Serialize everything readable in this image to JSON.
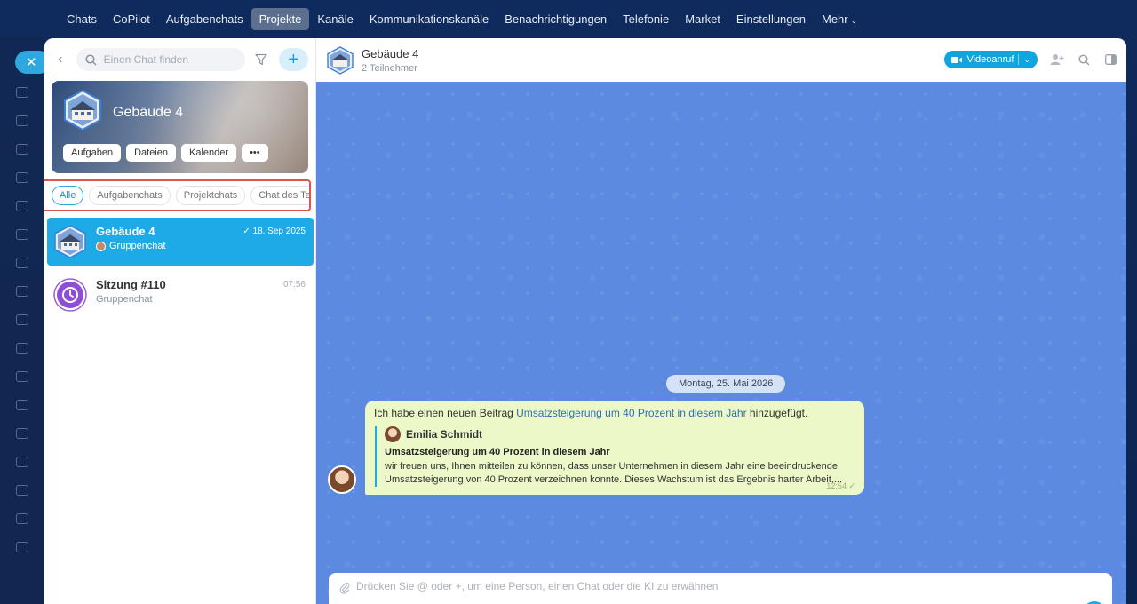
{
  "topnav": {
    "items": [
      "Chats",
      "CoPilot",
      "Aufgabenchats",
      "Projekte",
      "Kanäle",
      "Kommunikationskanäle",
      "Benachrichtigungen",
      "Telefonie",
      "Market",
      "Einstellungen",
      "Mehr"
    ],
    "active_index": 3
  },
  "left": {
    "search_placeholder": "Einen Chat finden",
    "add_label": "+",
    "project": {
      "title": "Gebäude 4",
      "actions": [
        "Aufgaben",
        "Dateien",
        "Kalender",
        "•••"
      ]
    },
    "tabs": [
      "Alle",
      "Aufgabenchats",
      "Projektchats",
      "Chat des Te"
    ],
    "chats": [
      {
        "name": "Gebäude 4",
        "sub": "Gruppenchat",
        "time": "✓ 18. Sep 2025",
        "selected": true
      },
      {
        "name": "Sitzung #110",
        "sub": "Gruppenchat",
        "time": "07:56",
        "selected": false
      }
    ]
  },
  "header": {
    "title": "Gebäude 4",
    "subtitle": "2 Teilnehmer",
    "video_label": "Videoanruf"
  },
  "conversation": {
    "date": "Montag, 25. Mai 2026",
    "message": {
      "prefix": "Ich habe einen neuen Beitrag ",
      "link": "Umsatzsteigerung um 40 Prozent in diesem Jahr",
      "suffix": " hinzugefügt.",
      "quote_author": "Emilia Schmidt",
      "quote_title": "Umsatzsteigerung um 40 Prozent in diesem Jahr",
      "quote_text": "wir freuen uns, Ihnen mitteilen zu können, dass unser Unternehmen in diesem Jahr eine beeindruckende Umsatzsteigerung von 40 Prozent verzeichnen konnte. Dieses Wachstum ist das Ergebnis harter Arbeit,...",
      "time": "12:54 ✓"
    }
  },
  "composer": {
    "placeholder": "Drücken Sie @ oder +, um eine Person, einen Chat oder die KI zu erwähnen"
  },
  "colors": {
    "accent": "#1eaae6",
    "chat_background": "#5b8ae0",
    "bubble": "#ecf8c8",
    "highlight_border": "#e0564f"
  }
}
